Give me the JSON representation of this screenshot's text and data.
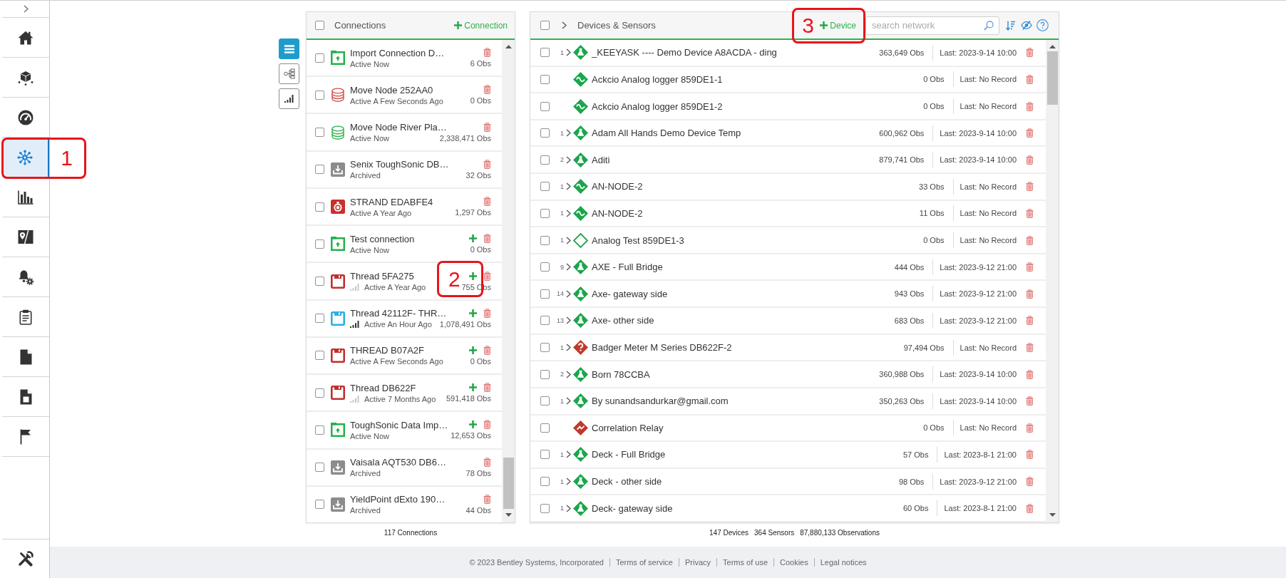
{
  "sidebar": {
    "expanded": false,
    "items": [
      {
        "selected": false
      },
      {
        "selected": false
      },
      {
        "selected": false
      },
      {
        "selected": true,
        "callout": "1"
      },
      {
        "selected": false
      },
      {
        "selected": false
      },
      {
        "selected": false
      },
      {
        "selected": false
      },
      {
        "selected": false
      },
      {
        "selected": false
      },
      {
        "selected": false
      }
    ],
    "bottom_items": [
      {
        "selected": false
      }
    ]
  },
  "view_buttons": [
    {
      "selected": true
    },
    {
      "selected": false
    },
    {
      "selected": false
    }
  ],
  "connections": {
    "header": {
      "checked": false,
      "title": "Connections",
      "add_label": "Connection"
    },
    "rows": [
      {
        "checked": false,
        "kind": "import",
        "color": "#22b24c",
        "name": "Import Connection D…",
        "status": "Active Now",
        "obs": "6 Obs",
        "can_add": false
      },
      {
        "checked": false,
        "kind": "database",
        "color": "#d0514b",
        "name": "Move Node 252AA0",
        "status": "Active A Few Seconds Ago",
        "obs": "0 Obs",
        "can_add": false
      },
      {
        "checked": false,
        "kind": "database",
        "color": "#2fb34f",
        "name": "Move Node River Pla…",
        "status": "Active Now",
        "obs": "2,338,471 Obs",
        "can_add": false
      },
      {
        "checked": false,
        "kind": "archive",
        "color": "#8c8c8c",
        "name": "Senix ToughSonic DB…",
        "status": "Archived",
        "obs": "32 Obs",
        "can_add": false
      },
      {
        "checked": false,
        "kind": "strand",
        "color": "#c9302c",
        "name": "STRAND EDABFE4",
        "status": "Active A Year Ago",
        "obs": "1,297 Obs",
        "can_add": false
      },
      {
        "checked": false,
        "kind": "import",
        "color": "#22b24c",
        "name": "Test connection",
        "status": "Active Now",
        "obs": "0 Obs",
        "can_add": true
      },
      {
        "checked": false,
        "kind": "thread",
        "color": "#c0302e",
        "name": "Thread 5FA275",
        "signal": {
          "on": false
        },
        "status": "Active A Year Ago",
        "callout": "2",
        "obs": "755 Obs",
        "can_add": true
      },
      {
        "checked": false,
        "kind": "thread",
        "color": "#2bb0e0",
        "name": "Thread 42112F- THR…",
        "signal": {
          "on": true
        },
        "status": "Active An Hour Ago",
        "obs": "1,078,491 Obs",
        "can_add": true
      },
      {
        "checked": false,
        "kind": "thread",
        "color": "#c0302e",
        "name": "THREAD B07A2F",
        "status": "Active A Few Seconds Ago",
        "obs": "0 Obs",
        "can_add": true
      },
      {
        "checked": false,
        "kind": "thread",
        "color": "#c0302e",
        "name": "Thread DB622F",
        "signal": {
          "on": false
        },
        "status": "Active 7 Months Ago",
        "obs": "591,418 Obs",
        "can_add": true
      },
      {
        "checked": false,
        "kind": "import",
        "color": "#22b24c",
        "name": "ToughSonic Data Imp…",
        "status": "Active Now",
        "obs": "12,653 Obs",
        "can_add": true
      },
      {
        "checked": false,
        "kind": "archive",
        "color": "#8c8c8c",
        "name": "Vaisala AQT530 DB6…",
        "status": "Archived",
        "obs": "78 Obs",
        "can_add": false
      },
      {
        "checked": false,
        "kind": "archive",
        "color": "#8c8c8c",
        "name": "YieldPoint dExto 190…",
        "status": "Archived",
        "obs": "44 Obs",
        "can_add": false
      }
    ],
    "total": "117 Connections"
  },
  "devices": {
    "header": {
      "checked": false,
      "expanded": false,
      "title": "Devices & Sensors",
      "callout": "3",
      "add_label": "Device",
      "search": {
        "placeholder": "search network"
      }
    },
    "rows": [
      {
        "checked": false,
        "count": "1",
        "expanded": false,
        "kind": "flask",
        "color": "#1aa64b",
        "name": "_KEEYASK ---- Demo Device A8ACDA - ding",
        "obs": "363,649 Obs",
        "last": "Last: 2023-9-14 10:00"
      },
      {
        "checked": false,
        "kind": "wave",
        "color": "#1aa64b",
        "name": "Ackcio Analog logger 859DE1-1",
        "obs": "0 Obs",
        "last": "Last: No Record"
      },
      {
        "checked": false,
        "kind": "wave",
        "color": "#1aa64b",
        "name": "Ackcio Analog logger 859DE1-2",
        "obs": "0 Obs",
        "last": "Last: No Record"
      },
      {
        "checked": false,
        "count": "1",
        "expanded": false,
        "kind": "flask",
        "color": "#1aa64b",
        "name": "Adam All Hands Demo Device Temp",
        "obs": "600,962 Obs",
        "last": "Last: 2023-9-14 10:00"
      },
      {
        "checked": false,
        "count": "2",
        "expanded": false,
        "kind": "flask",
        "color": "#1aa64b",
        "name": "Aditi",
        "obs": "879,741 Obs",
        "last": "Last: 2023-9-14 10:00"
      },
      {
        "checked": false,
        "count": "1",
        "expanded": false,
        "kind": "wave",
        "color": "#1aa64b",
        "name": "AN-NODE-2",
        "obs": "33 Obs",
        "last": "Last: No Record"
      },
      {
        "checked": false,
        "count": "1",
        "expanded": false,
        "kind": "wave",
        "color": "#1aa64b",
        "name": "AN-NODE-2",
        "obs": "11 Obs",
        "last": "Last: No Record"
      },
      {
        "checked": false,
        "count": "1",
        "expanded": false,
        "kind": "outline",
        "color": "#1aa64b",
        "name": "Analog Test 859DE1-3",
        "obs": "0 Obs",
        "last": "Last: No Record"
      },
      {
        "checked": false,
        "count": "9",
        "expanded": false,
        "kind": "flask",
        "color": "#1aa64b",
        "name": "AXE - Full Bridge",
        "obs": "444 Obs",
        "last": "Last: 2023-9-12 21:00"
      },
      {
        "checked": false,
        "count": "14",
        "expanded": false,
        "kind": "flask",
        "color": "#1aa64b",
        "name": "Axe- gateway side",
        "obs": "943 Obs",
        "last": "Last: 2023-9-12 21:00"
      },
      {
        "checked": false,
        "count": "13",
        "expanded": false,
        "kind": "flask",
        "color": "#1aa64b",
        "name": "Axe- other side",
        "obs": "683 Obs",
        "last": "Last: 2023-9-12 21:00"
      },
      {
        "checked": false,
        "count": "1",
        "expanded": false,
        "kind": "alert",
        "color": "#c0392b",
        "name": "Badger Meter M Series DB622F-2",
        "obs": "97,494 Obs",
        "last": "Last: No Record"
      },
      {
        "checked": false,
        "count": "2",
        "expanded": false,
        "kind": "flask",
        "color": "#1aa64b",
        "name": "Born 78CCBA",
        "obs": "360,988 Obs",
        "last": "Last: 2023-9-14 10:00"
      },
      {
        "checked": false,
        "count": "1",
        "expanded": false,
        "kind": "flask",
        "color": "#1aa64b",
        "name": "By sunandsandurkar@gmail.com",
        "obs": "350,263 Obs",
        "last": "Last: 2023-9-14 10:00"
      },
      {
        "checked": false,
        "kind": "relay",
        "color": "#c0392b",
        "name": "Correlation Relay",
        "obs": "0 Obs",
        "last": "Last: No Record"
      },
      {
        "checked": false,
        "count": "1",
        "expanded": false,
        "kind": "flask",
        "color": "#1aa64b",
        "name": "Deck - Full Bridge",
        "obs": "57 Obs",
        "last": "Last: 2023-8-1 21:00"
      },
      {
        "checked": false,
        "count": "1",
        "expanded": false,
        "kind": "flask",
        "color": "#1aa64b",
        "name": "Deck - other side",
        "obs": "98 Obs",
        "last": "Last: 2023-9-12 21:00"
      },
      {
        "checked": false,
        "count": "1",
        "expanded": false,
        "kind": "flask",
        "color": "#1aa64b",
        "name": "Deck- gateway side",
        "obs": "60 Obs",
        "last": "Last: 2023-8-1 21:00"
      }
    ],
    "totals": [
      "147 Devices",
      "364 Sensors",
      "87,880,133 Observations"
    ]
  },
  "footer": {
    "copyright": "© 2023 Bentley Systems, Incorporated",
    "links": [
      "Terms of service",
      "Privacy",
      "Terms of use",
      "Cookies",
      "Legal notices"
    ]
  }
}
